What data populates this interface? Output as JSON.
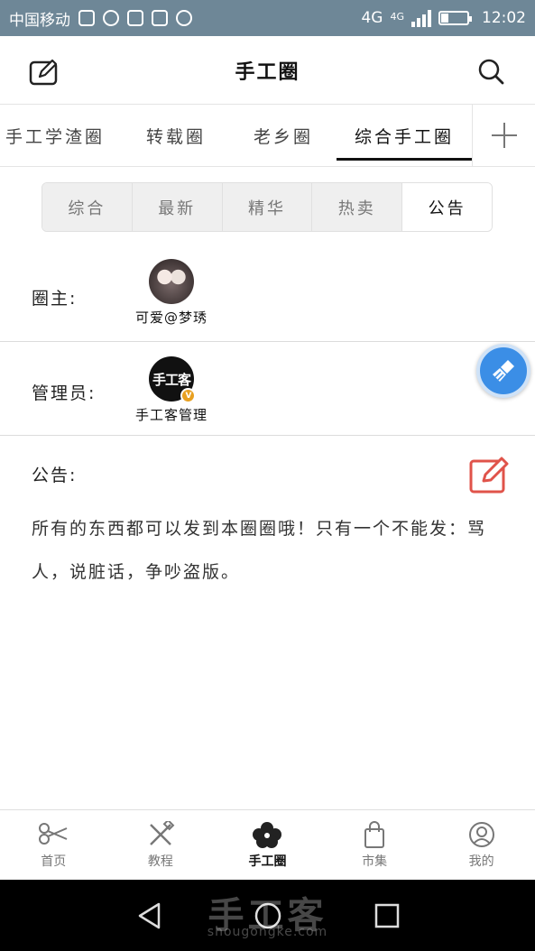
{
  "status_bar": {
    "carrier": "中国移动",
    "network_1": "4G",
    "network_2": "4G",
    "time": "12:02"
  },
  "header": {
    "title": "手工圈"
  },
  "circle_tabs": [
    {
      "label": "手工学渣圈"
    },
    {
      "label": "转载圈"
    },
    {
      "label": "老乡圈"
    },
    {
      "label": "综合手工圈",
      "active": true
    }
  ],
  "segments": [
    {
      "label": "综合"
    },
    {
      "label": "最新"
    },
    {
      "label": "精华"
    },
    {
      "label": "热卖"
    },
    {
      "label": "公告",
      "active": true
    }
  ],
  "owner": {
    "label": "圈主:",
    "name": "可爱@梦琇"
  },
  "admin": {
    "label": "管理员:",
    "name": "手工客管理",
    "avatar_text": "手工客",
    "badge": "V"
  },
  "notice": {
    "label": "公告:",
    "text": "所有的东西都可以发到本圈圈哦！只有一个不能发：骂人，说脏话，争吵盗版。"
  },
  "bottom_nav": [
    {
      "label": "首页",
      "icon": "scissors-icon"
    },
    {
      "label": "教程",
      "icon": "tools-icon"
    },
    {
      "label": "手工圈",
      "icon": "flower-icon",
      "active": true
    },
    {
      "label": "市集",
      "icon": "shopping-bag-icon"
    },
    {
      "label": "我的",
      "icon": "user-icon"
    }
  ],
  "watermark": {
    "text": "手工客",
    "url": "shougongke.com"
  },
  "colors": {
    "status_bar": "#6e8797",
    "fab": "#3b8ee6",
    "notice_edit": "#e0534a"
  }
}
